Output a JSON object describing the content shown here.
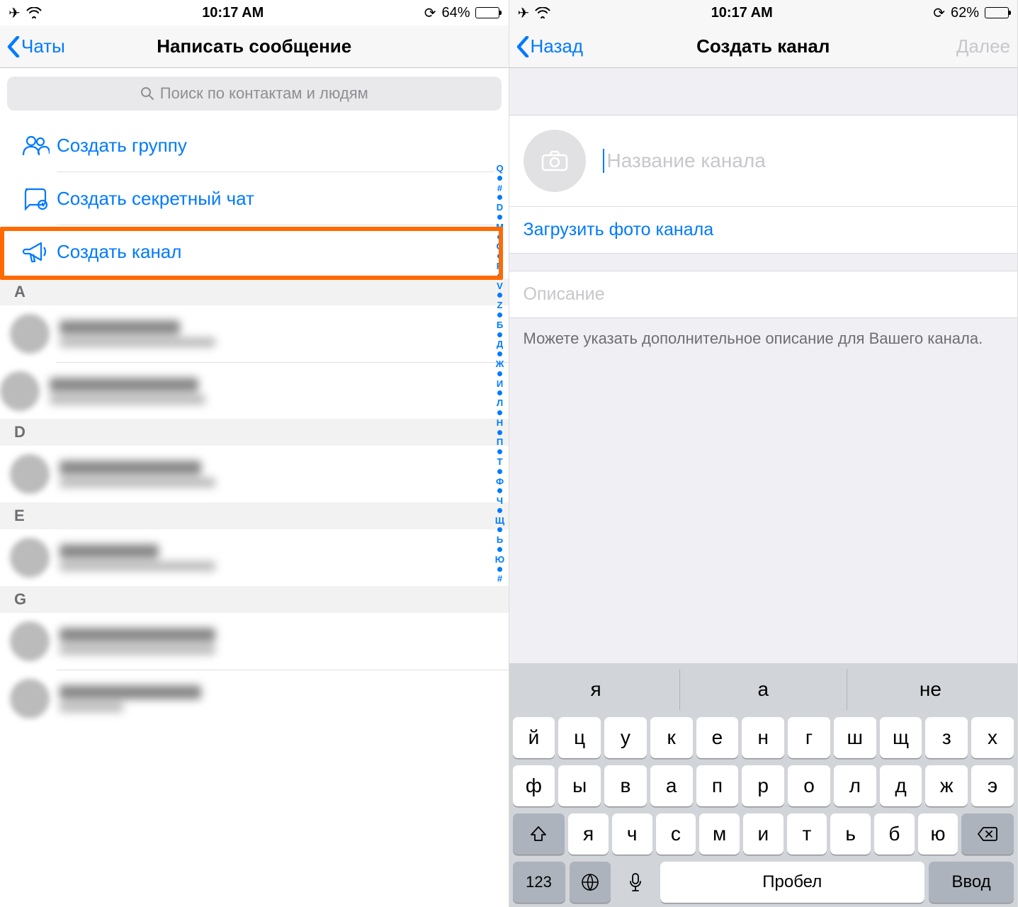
{
  "screen1": {
    "statusbar": {
      "time": "10:17 AM",
      "battery_pct": "64%"
    },
    "nav": {
      "back": "Чаты",
      "title": "Написать сообщение"
    },
    "search_placeholder": "Поиск по контактам и людям",
    "actions": {
      "group": "Создать группу",
      "secret": "Создать секретный чат",
      "channel": "Создать канал"
    },
    "sections": [
      "A",
      "D",
      "E",
      "G"
    ],
    "index_letters": [
      "Q",
      "#",
      "D",
      "M",
      "O",
      "R",
      "V",
      "Z",
      "Б",
      "Д",
      "Ж",
      "И",
      "Л",
      "Н",
      "П",
      "Т",
      "Ф",
      "Ч",
      "Щ",
      "Ь",
      "Ю",
      "#"
    ]
  },
  "screen2": {
    "statusbar": {
      "time": "10:17 AM",
      "battery_pct": "62%"
    },
    "nav": {
      "back": "Назад",
      "title": "Создать канал",
      "next": "Далее"
    },
    "name_placeholder": "Название канала",
    "upload_label": "Загрузить фото канала",
    "desc_placeholder": "Описание",
    "hint": "Можете указать дополнительное описание для Вашего канала.",
    "keyboard": {
      "suggestions": [
        "я",
        "а",
        "не"
      ],
      "row1": [
        "й",
        "ц",
        "у",
        "к",
        "е",
        "н",
        "г",
        "ш",
        "щ",
        "з",
        "х"
      ],
      "row2": [
        "ф",
        "ы",
        "в",
        "а",
        "п",
        "р",
        "о",
        "л",
        "д",
        "ж",
        "э"
      ],
      "row3": [
        "я",
        "ч",
        "с",
        "м",
        "и",
        "т",
        "ь",
        "б",
        "ю"
      ],
      "num": "123",
      "space": "Пробел",
      "enter": "Ввод"
    }
  }
}
